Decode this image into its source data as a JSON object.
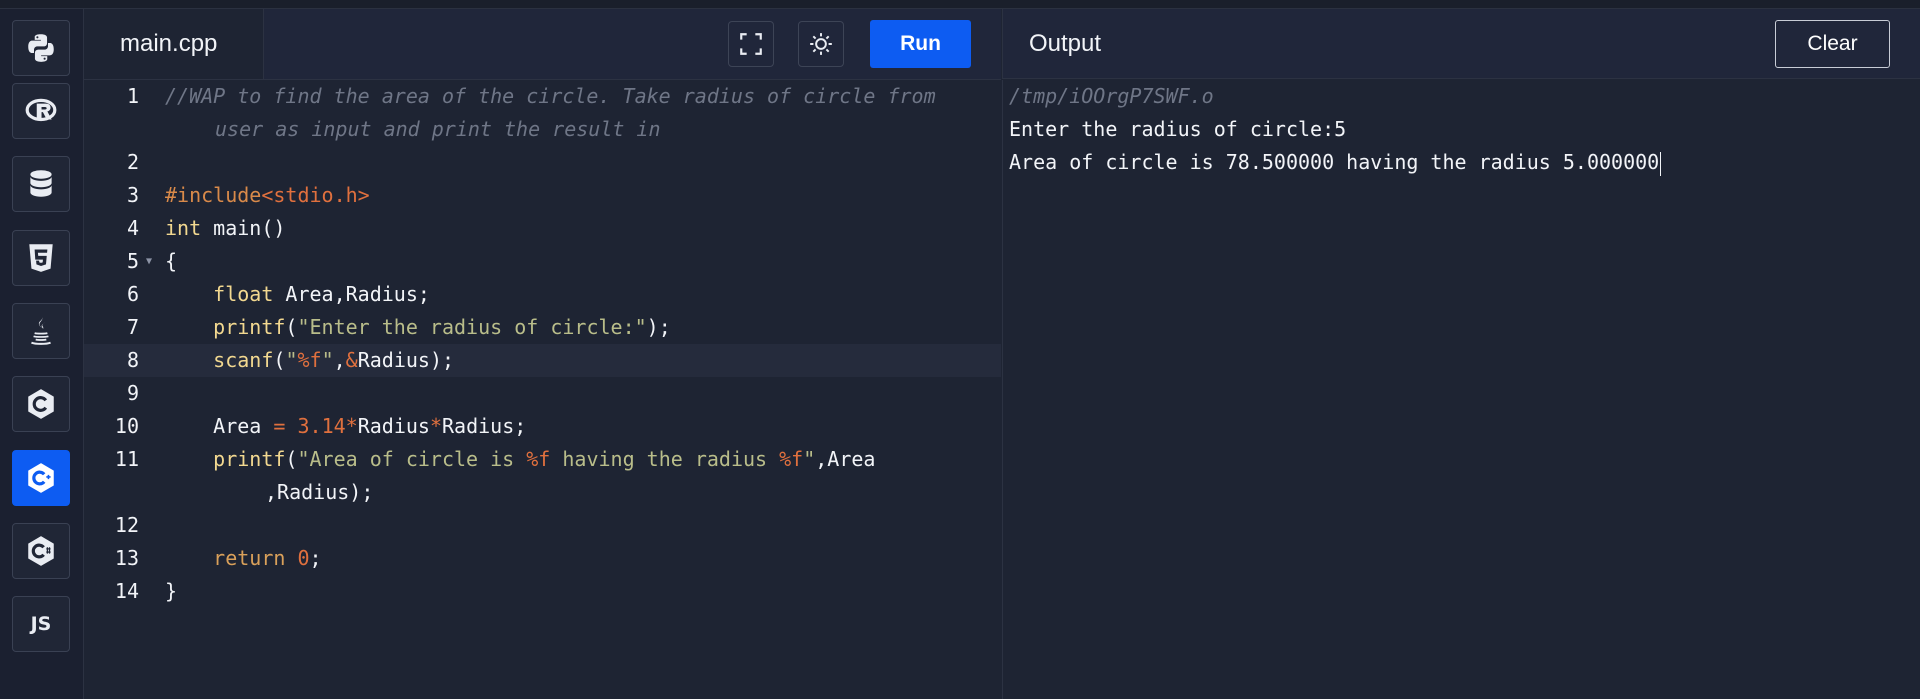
{
  "editor": {
    "file_tab": "main.cpp",
    "run_label": "Run",
    "line_numbers": [
      "1",
      "2",
      "3",
      "4",
      "5",
      "6",
      "7",
      "8",
      "9",
      "10",
      "11",
      "12",
      "13",
      "14"
    ],
    "code": {
      "l1a": "//WAP to find the area of the circle. Take radius of circle from",
      "l1b": "user as input and print the result in",
      "l3_inc": "#include",
      "l3_hdr": "<stdio.h>",
      "l4_kw": "int",
      "l4_rest": " main()",
      "l5": "{",
      "l6_kw": "float",
      "l6_rest": " Area,Radius;",
      "l7_fn": "printf",
      "l7_open": "(",
      "l7_str": "\"Enter the radius of circle:\"",
      "l7_close": ");",
      "l8_fn": "scanf",
      "l8_open": "(",
      "l8_q1": "\"",
      "l8_fmt": "%f",
      "l8_q2": "\"",
      "l8_comma": ",",
      "l8_amp": "&",
      "l8_rest": "Radius);",
      "l10_a": "Area ",
      "l10_eq": "=",
      "l10_sp": " ",
      "l10_num": "3.14",
      "l10_op1": "*",
      "l10_r1": "Radius",
      "l10_op2": "*",
      "l10_r2": "Radius;",
      "l11_fn": "printf",
      "l11_open": "(",
      "l11_s1": "\"Area of circle is ",
      "l11_f1": "%f",
      "l11_s2": " having the radius ",
      "l11_f2": "%f",
      "l11_s3": "\"",
      "l11_rest": ",Area",
      "l11b": ",Radius);",
      "l13_kw": "return",
      "l13_sp": " ",
      "l13_num": "0",
      "l13_end": ";",
      "l14": "}"
    }
  },
  "output": {
    "title": "Output",
    "clear_label": "Clear",
    "lines": [
      "/tmp/iOOrgP7SWF.o",
      "Enter the radius of circle:5",
      "Area of circle is 78.500000 having the radius 5.000000"
    ]
  },
  "sidebar": {
    "items": [
      {
        "name": "python",
        "icon": "python-icon"
      },
      {
        "name": "r",
        "icon": "r-icon"
      },
      {
        "name": "sql",
        "icon": "database-icon"
      },
      {
        "name": "html",
        "icon": "html5-icon"
      },
      {
        "name": "java",
        "icon": "java-icon"
      },
      {
        "name": "c",
        "icon": "c-icon"
      },
      {
        "name": "cpp",
        "icon": "cpp-icon",
        "active": true
      },
      {
        "name": "csharp",
        "icon": "csharp-icon"
      },
      {
        "name": "js",
        "icon": "js-icon",
        "label": "JS"
      }
    ]
  },
  "colors": {
    "background": "#1e2433",
    "accent": "#0d5cf2",
    "string": "#b9bd8a",
    "keyword": "#f2d890",
    "number": "#e0703e",
    "comment": "#6f7687"
  }
}
